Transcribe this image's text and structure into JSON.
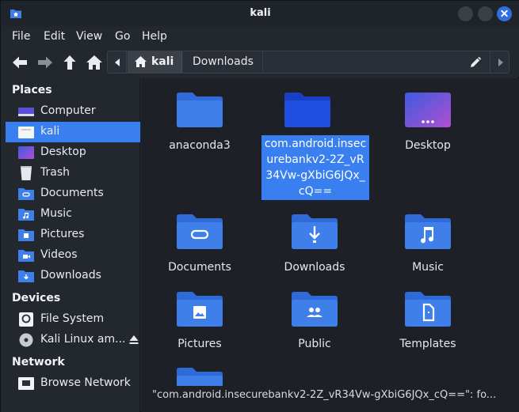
{
  "window": {
    "title": "kali"
  },
  "menu": [
    "File",
    "Edit",
    "View",
    "Go",
    "Help"
  ],
  "pathbar": {
    "home_label": "kali",
    "current_label": "Downloads"
  },
  "sidebar": {
    "places_title": "Places",
    "places": [
      {
        "label": "Computer",
        "icon": "computer-icon"
      },
      {
        "label": "kali",
        "icon": "home-folder-icon",
        "active": true
      },
      {
        "label": "Desktop",
        "icon": "desktop-icon"
      },
      {
        "label": "Trash",
        "icon": "trash-icon"
      },
      {
        "label": "Documents",
        "icon": "documents-folder-icon"
      },
      {
        "label": "Music",
        "icon": "music-folder-icon"
      },
      {
        "label": "Pictures",
        "icon": "pictures-folder-icon"
      },
      {
        "label": "Videos",
        "icon": "videos-folder-icon"
      },
      {
        "label": "Downloads",
        "icon": "downloads-folder-icon"
      }
    ],
    "devices_title": "Devices",
    "devices": [
      {
        "label": "File System",
        "icon": "drive-icon"
      },
      {
        "label": "Kali Linux am...",
        "icon": "disc-icon"
      }
    ],
    "network_title": "Network",
    "network": [
      {
        "label": "Browse Network",
        "icon": "network-icon"
      }
    ]
  },
  "files": [
    {
      "name": "anaconda3",
      "icon": "folder-icon"
    },
    {
      "name": "com.android.insecurebankv2-2Z_vR34Vw-gXbiG6JQx_cQ==",
      "icon": "folder-icon",
      "selected": true
    },
    {
      "name": "Desktop",
      "icon": "desktop-folder-icon"
    },
    {
      "name": "Documents",
      "icon": "documents-folder-icon"
    },
    {
      "name": "Downloads",
      "icon": "downloads-folder-icon"
    },
    {
      "name": "Music",
      "icon": "music-folder-icon"
    },
    {
      "name": "Pictures",
      "icon": "pictures-folder-icon"
    },
    {
      "name": "Public",
      "icon": "public-folder-icon"
    },
    {
      "name": "Templates",
      "icon": "templates-folder-icon"
    },
    {
      "name": "",
      "icon": "folder-icon"
    }
  ],
  "status": {
    "text": "\"com.android.insecurebankv2-2Z_vR34Vw-gXbiG6JQx_cQ==\": fo..."
  },
  "colors": {
    "accent": "#3a7ff0",
    "folder": "#3f7fea",
    "selected_folder": "#1f4fe0",
    "background": "#1d2127"
  }
}
